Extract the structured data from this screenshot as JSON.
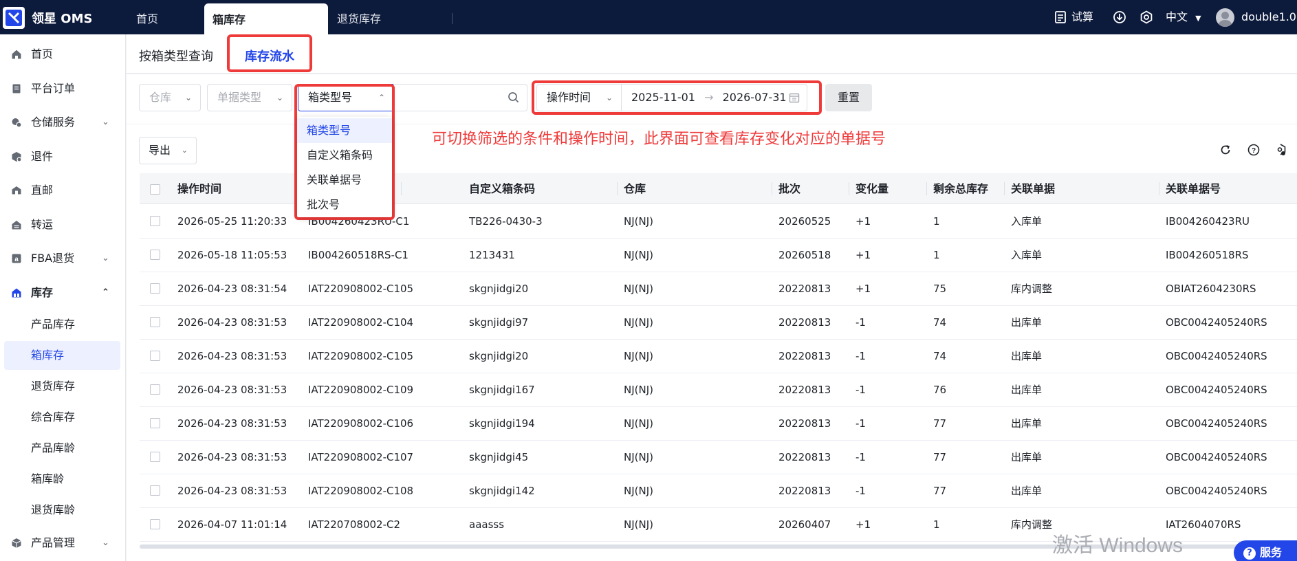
{
  "app": {
    "brand": "领星 OMS"
  },
  "topbar": {
    "tabs": [
      {
        "label": "首页"
      },
      {
        "label": "箱库存"
      },
      {
        "label": "退货库存"
      }
    ],
    "calc_label": "试算",
    "language": "中文",
    "username": "double1.0"
  },
  "sidebar": {
    "items": [
      {
        "label": "首页",
        "icon": "home-icon"
      },
      {
        "label": "平台订单",
        "icon": "order-icon"
      },
      {
        "label": "仓储服务",
        "icon": "warehouse-icon",
        "expandable": true
      },
      {
        "label": "退件",
        "icon": "return-icon"
      },
      {
        "label": "直邮",
        "icon": "mail-icon"
      },
      {
        "label": "转运",
        "icon": "transfer-icon"
      },
      {
        "label": "FBA退货",
        "icon": "amazon-icon",
        "expandable": true
      },
      {
        "label": "库存",
        "icon": "inventory-icon",
        "expanded": true
      }
    ],
    "sub_items": [
      {
        "label": "产品库存"
      },
      {
        "label": "箱库存",
        "active": true
      },
      {
        "label": "退货库存"
      },
      {
        "label": "综合库存"
      },
      {
        "label": "产品库龄"
      },
      {
        "label": "箱库龄"
      },
      {
        "label": "退货库龄"
      }
    ],
    "bottom_item": {
      "label": "产品管理",
      "icon": "product-icon"
    }
  },
  "subtabs": [
    {
      "label": "按箱类型查询"
    },
    {
      "label": "库存流水",
      "active": true
    }
  ],
  "filters": {
    "warehouse_placeholder": "仓库",
    "doc_type_placeholder": "单据类型",
    "search_field": "箱类型号",
    "time_field": "操作时间",
    "date_start": "2025-11-01",
    "date_end": "2026-07-31",
    "reset_label": "重置"
  },
  "dropdown": {
    "options": [
      "箱类型号",
      "自定义箱条码",
      "关联单据号",
      "批次号"
    ],
    "selected": "箱类型号"
  },
  "annotation": "可切换筛选的条件和操作时间，此界面可查看库存变化对应的单据号",
  "toolbar": {
    "export_label": "导出"
  },
  "table": {
    "columns": [
      "操作时间",
      "自定义箱条码",
      "仓库",
      "批次",
      "变化量",
      "剩余总库存",
      "关联单据",
      "关联单据号"
    ],
    "rows": [
      {
        "time": "2026-05-25 11:20:33",
        "box": "IB004260423RU-C1",
        "code": "TB226-0430-3",
        "wh": "NJ(NJ)",
        "batch": "20260525",
        "change": "+1",
        "remain": "1",
        "doc": "入库单",
        "docno": "IB004260423RU"
      },
      {
        "time": "2026-05-18 11:05:53",
        "box": "IB004260518RS-C1",
        "code": "1213431",
        "wh": "NJ(NJ)",
        "batch": "20260518",
        "change": "+1",
        "remain": "1",
        "doc": "入库单",
        "docno": "IB004260518RS"
      },
      {
        "time": "2026-04-23 08:31:54",
        "box": "IAT220908002-C105",
        "code": "skgnjidgi20",
        "wh": "NJ(NJ)",
        "batch": "20220813",
        "change": "+1",
        "remain": "75",
        "doc": "库内调整",
        "docno": "OBIAT2604230RS"
      },
      {
        "time": "2026-04-23 08:31:53",
        "box": "IAT220908002-C104",
        "code": "skgnjidgi97",
        "wh": "NJ(NJ)",
        "batch": "20220813",
        "change": "-1",
        "remain": "74",
        "doc": "出库单",
        "docno": "OBC0042405240RS"
      },
      {
        "time": "2026-04-23 08:31:53",
        "box": "IAT220908002-C105",
        "code": "skgnjidgi20",
        "wh": "NJ(NJ)",
        "batch": "20220813",
        "change": "-1",
        "remain": "74",
        "doc": "出库单",
        "docno": "OBC0042405240RS"
      },
      {
        "time": "2026-04-23 08:31:53",
        "box": "IAT220908002-C109",
        "code": "skgnjidgi167",
        "wh": "NJ(NJ)",
        "batch": "20220813",
        "change": "-1",
        "remain": "76",
        "doc": "出库单",
        "docno": "OBC0042405240RS"
      },
      {
        "time": "2026-04-23 08:31:53",
        "box": "IAT220908002-C106",
        "code": "skgnjidgi194",
        "wh": "NJ(NJ)",
        "batch": "20220813",
        "change": "-1",
        "remain": "77",
        "doc": "出库单",
        "docno": "OBC0042405240RS"
      },
      {
        "time": "2026-04-23 08:31:53",
        "box": "IAT220908002-C107",
        "code": "skgnjidgi45",
        "wh": "NJ(NJ)",
        "batch": "20220813",
        "change": "-1",
        "remain": "77",
        "doc": "出库单",
        "docno": "OBC0042405240RS"
      },
      {
        "time": "2026-04-23 08:31:53",
        "box": "IAT220908002-C108",
        "code": "skgnjidgi142",
        "wh": "NJ(NJ)",
        "batch": "20220813",
        "change": "-1",
        "remain": "77",
        "doc": "出库单",
        "docno": "OBC0042405240RS"
      },
      {
        "time": "2026-04-07 11:01:14",
        "box": "IAT220708002-C2",
        "code": "aaasss",
        "wh": "NJ(NJ)",
        "batch": "20260407",
        "change": "+1",
        "remain": "1",
        "doc": "库内调整",
        "docno": "IAT2604070RS"
      }
    ]
  },
  "watermark": "激活 Windows",
  "service_label": "服务",
  "colors": {
    "accent": "#2346e8",
    "topbar": "#0c1a3c",
    "highlight": "#ef3a3a"
  }
}
